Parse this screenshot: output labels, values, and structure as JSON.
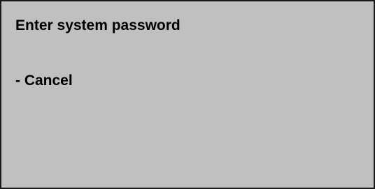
{
  "screen": {
    "prompt": "Enter system password",
    "cancel_label": "- Cancel",
    "background_color": "#c0c0c0",
    "border_color": "#1a1a1a"
  }
}
